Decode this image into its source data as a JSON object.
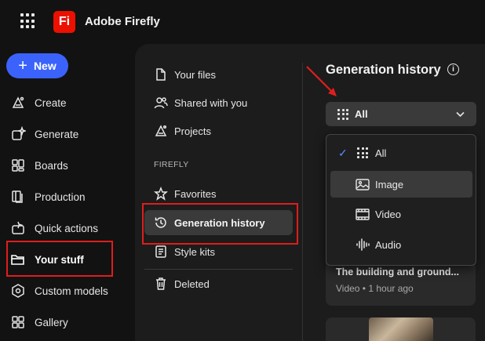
{
  "header": {
    "app_name": "Adobe Firefly",
    "logo_text": "Fi"
  },
  "nav": {
    "new_label": "New",
    "items": [
      {
        "label": "Create",
        "icon": "create-icon"
      },
      {
        "label": "Generate",
        "icon": "generate-icon"
      },
      {
        "label": "Boards",
        "icon": "boards-icon"
      },
      {
        "label": "Production",
        "icon": "production-icon"
      },
      {
        "label": "Quick actions",
        "icon": "quick-actions-icon"
      },
      {
        "label": "Your stuff",
        "icon": "folder-icon",
        "active": true
      },
      {
        "label": "Custom models",
        "icon": "custom-models-icon"
      },
      {
        "label": "Gallery",
        "icon": "gallery-icon"
      }
    ]
  },
  "files_panel": {
    "top_items": [
      {
        "label": "Your files",
        "icon": "file-icon"
      },
      {
        "label": "Shared with you",
        "icon": "people-icon"
      },
      {
        "label": "Projects",
        "icon": "projects-icon"
      }
    ],
    "section_label": "FIREFLY",
    "firefly_items": [
      {
        "label": "Favorites",
        "icon": "star-icon"
      },
      {
        "label": "Generation history",
        "icon": "history-icon",
        "selected": true
      },
      {
        "label": "Style kits",
        "icon": "style-kits-icon"
      }
    ],
    "deleted_label": "Deleted"
  },
  "main": {
    "title": "Generation history",
    "filter": {
      "selected": "All",
      "options": [
        {
          "label": "All",
          "icon": "grid-icon",
          "checked": true
        },
        {
          "label": "Image",
          "icon": "image-icon",
          "highlighted": true
        },
        {
          "label": "Video",
          "icon": "video-icon"
        },
        {
          "label": "Audio",
          "icon": "audio-icon"
        }
      ]
    },
    "card": {
      "title": "The building and ground...",
      "meta": "Video • 1 hour ago"
    }
  },
  "colors": {
    "accent": "#3b63fb",
    "brand": "#eb1000",
    "annotation": "#e01d1d",
    "check": "#5b8cff"
  }
}
